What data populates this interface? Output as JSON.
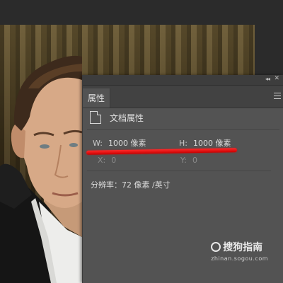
{
  "panel": {
    "tab_label": "属性",
    "doc_title": "文档属性",
    "width": {
      "label": "W:",
      "value": "1000 像素"
    },
    "height": {
      "label": "H:",
      "value": "1000 像素"
    },
    "x": {
      "label": "X:",
      "value": "0"
    },
    "y": {
      "label": "Y:",
      "value": "0"
    },
    "resolution": "分辨率：72 像素 /英寸"
  },
  "watermark": {
    "brand": "搜狗指南",
    "url": "zhinan.sogou.com"
  },
  "colors": {
    "highlight": "#e00000",
    "panel_bg": "#535353"
  }
}
